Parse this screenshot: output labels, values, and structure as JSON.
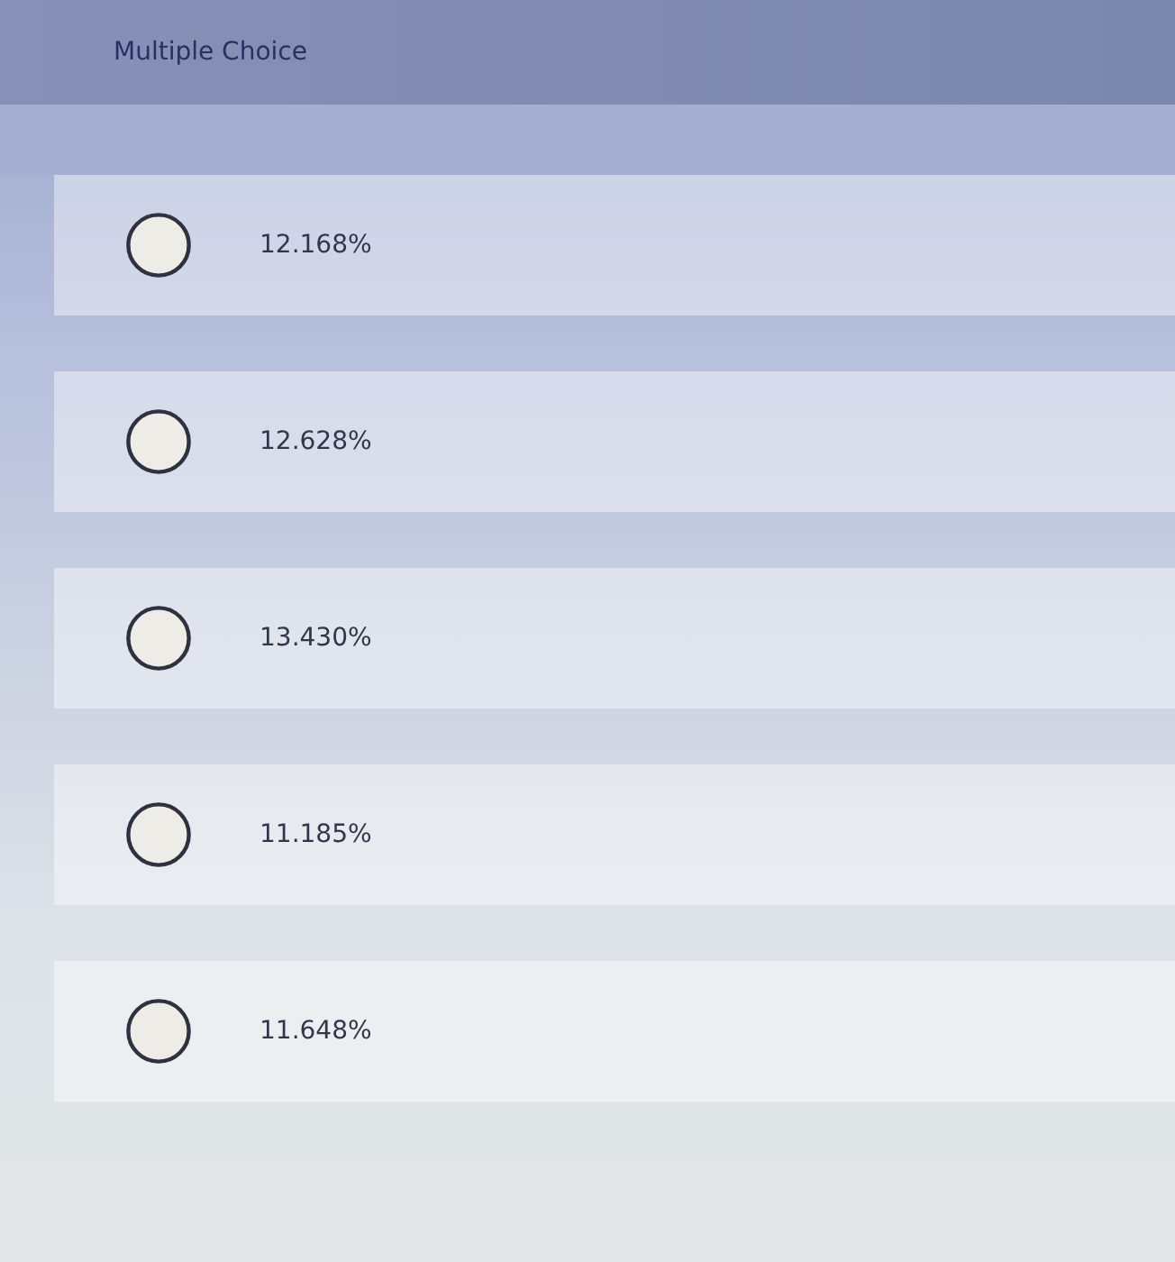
{
  "title": "Multiple Choice",
  "options": [
    {
      "label": "12.168%",
      "selected": false
    },
    {
      "label": "12.628%",
      "selected": false
    },
    {
      "label": "13.430%",
      "selected": false
    },
    {
      "label": "11.185%",
      "selected": false
    },
    {
      "label": "11.648%",
      "selected": false
    }
  ]
}
